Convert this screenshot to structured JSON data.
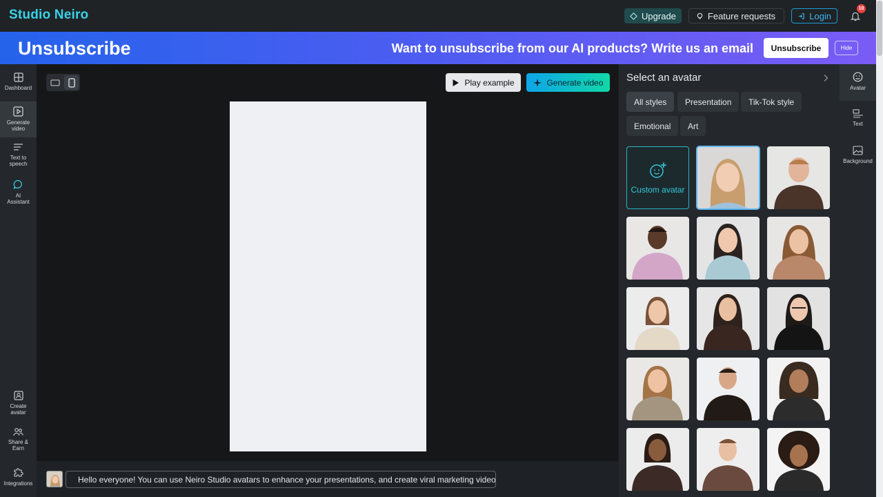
{
  "app": {
    "brand": "Studio Neiro"
  },
  "topbar": {
    "upgrade_label": "Upgrade",
    "feature_label": "Feature requests",
    "login_label": "Login",
    "notification_count": "10"
  },
  "banner": {
    "title": "Unsubscribe",
    "message": "Want to unsubscribe from our AI products? Write us an email",
    "unsubscribe_label": "Unsubscribe",
    "hide_label": "Hide"
  },
  "leftnav": {
    "items": [
      {
        "label": "Dashboard",
        "icon": "dashboard-icon"
      },
      {
        "label": "Generate video",
        "icon": "play-square-icon",
        "active": true
      },
      {
        "label": "Text to speech",
        "icon": "text-lines-icon"
      },
      {
        "label": "AI Assistant",
        "icon": "chat-bubble-icon"
      }
    ],
    "bottom_items": [
      {
        "label": "Create avatar",
        "icon": "user-card-icon"
      },
      {
        "label": "Share & Earn",
        "icon": "users-icon"
      },
      {
        "label": "Integrations",
        "icon": "puzzle-icon"
      }
    ]
  },
  "canvas": {
    "play_label": "Play example",
    "generate_label": "Generate video",
    "script_text": "Hello everyone! You can use Neiro Studio avatars to enhance your presentations, and create viral marketing videos!"
  },
  "avatar_panel": {
    "title": "Select an avatar",
    "filters": [
      "All styles",
      "Presentation",
      "Tik-Tok style",
      "Emotional",
      "Art"
    ],
    "active_filter": "All styles",
    "custom_label": "Custom avatar"
  },
  "toolstrip": {
    "items": [
      {
        "label": "Avatar",
        "icon": "smiley-icon"
      },
      {
        "label": "Text",
        "icon": "text-tool-icon"
      },
      {
        "label": "Background",
        "icon": "image-icon"
      }
    ]
  },
  "colors": {
    "accent": "#38d3e8",
    "banner_start": "#2563eb",
    "banner_end": "#7a5cf5"
  }
}
